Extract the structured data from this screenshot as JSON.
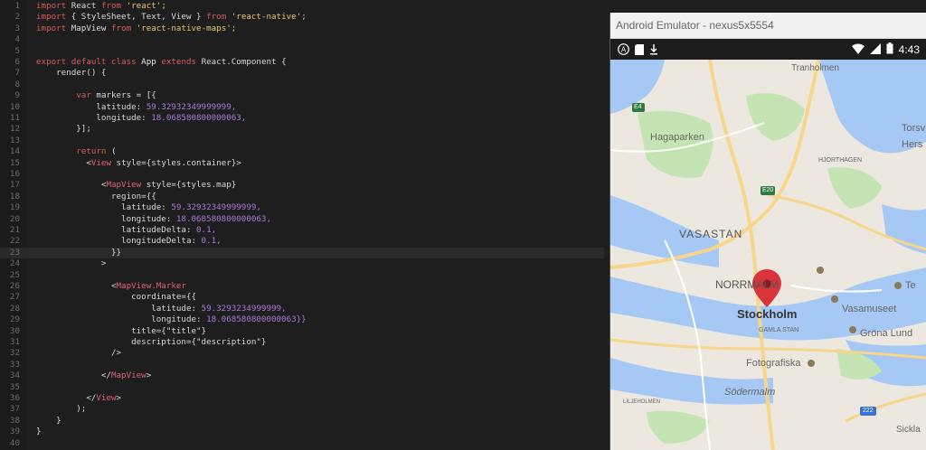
{
  "editor": {
    "lines": [
      {
        "n": "1",
        "seg": [
          {
            "t": "import ",
            "c": "kw"
          },
          {
            "t": "React ",
            "c": ""
          },
          {
            "t": "from ",
            "c": "kw"
          },
          {
            "t": "'react';",
            "c": "st"
          }
        ]
      },
      {
        "n": "2",
        "seg": [
          {
            "t": "import ",
            "c": "kw"
          },
          {
            "t": "{ StyleSheet, Text, View } ",
            "c": ""
          },
          {
            "t": "from ",
            "c": "kw"
          },
          {
            "t": "'react-native';",
            "c": "st"
          }
        ]
      },
      {
        "n": "3",
        "seg": [
          {
            "t": "import ",
            "c": "kw"
          },
          {
            "t": "MapView ",
            "c": ""
          },
          {
            "t": "from ",
            "c": "kw"
          },
          {
            "t": "'react-native-maps';",
            "c": "st"
          }
        ]
      },
      {
        "n": "4",
        "seg": []
      },
      {
        "n": "5",
        "seg": []
      },
      {
        "n": "6",
        "seg": [
          {
            "t": "export default class ",
            "c": "kw"
          },
          {
            "t": "App ",
            "c": "cl"
          },
          {
            "t": "extends ",
            "c": "kw"
          },
          {
            "t": "React.Component {",
            "c": ""
          }
        ]
      },
      {
        "n": "7",
        "seg": [
          {
            "t": "    render() {",
            "c": ""
          }
        ]
      },
      {
        "n": "8",
        "seg": []
      },
      {
        "n": "9",
        "seg": [
          {
            "t": "        ",
            "c": ""
          },
          {
            "t": "var ",
            "c": "kw"
          },
          {
            "t": "markers = [{",
            "c": ""
          }
        ]
      },
      {
        "n": "10",
        "seg": [
          {
            "t": "            latitude: ",
            "c": ""
          },
          {
            "t": "59.32932349999999,",
            "c": "nm"
          }
        ]
      },
      {
        "n": "11",
        "seg": [
          {
            "t": "            longitude: ",
            "c": ""
          },
          {
            "t": "18.068580800000063,",
            "c": "nm"
          }
        ]
      },
      {
        "n": "12",
        "seg": [
          {
            "t": "        }];",
            "c": ""
          }
        ]
      },
      {
        "n": "13",
        "seg": []
      },
      {
        "n": "14",
        "seg": [
          {
            "t": "        ",
            "c": ""
          },
          {
            "t": "return ",
            "c": "kw"
          },
          {
            "t": "(",
            "c": ""
          }
        ]
      },
      {
        "n": "15",
        "seg": [
          {
            "t": "          <",
            "c": ""
          },
          {
            "t": "View ",
            "c": "tg"
          },
          {
            "t": "style={styles.container}>",
            "c": ""
          }
        ]
      },
      {
        "n": "16",
        "seg": []
      },
      {
        "n": "17",
        "seg": [
          {
            "t": "             <",
            "c": ""
          },
          {
            "t": "MapView ",
            "c": "tg"
          },
          {
            "t": "style={styles.map}",
            "c": ""
          }
        ]
      },
      {
        "n": "18",
        "seg": [
          {
            "t": "               region={{",
            "c": ""
          }
        ]
      },
      {
        "n": "19",
        "seg": [
          {
            "t": "                 latitude: ",
            "c": ""
          },
          {
            "t": "59.32932349999999,",
            "c": "nm"
          }
        ]
      },
      {
        "n": "20",
        "seg": [
          {
            "t": "                 longitude: ",
            "c": ""
          },
          {
            "t": "18.068580800000063,",
            "c": "nm"
          }
        ]
      },
      {
        "n": "21",
        "seg": [
          {
            "t": "                 latitudeDelta: ",
            "c": ""
          },
          {
            "t": "0.1,",
            "c": "nm"
          }
        ]
      },
      {
        "n": "22",
        "seg": [
          {
            "t": "                 longitudeDelta: ",
            "c": ""
          },
          {
            "t": "0.1,",
            "c": "nm"
          }
        ]
      },
      {
        "n": "23",
        "seg": [
          {
            "t": "               }}",
            "c": ""
          }
        ]
      },
      {
        "n": "24",
        "seg": [
          {
            "t": "             >",
            "c": ""
          }
        ]
      },
      {
        "n": "25",
        "seg": []
      },
      {
        "n": "26",
        "seg": [
          {
            "t": "               <",
            "c": ""
          },
          {
            "t": "MapView.Marker",
            "c": "tg"
          }
        ]
      },
      {
        "n": "27",
        "seg": [
          {
            "t": "                   coordinate={{",
            "c": ""
          }
        ]
      },
      {
        "n": "28",
        "seg": [
          {
            "t": "                       latitude: ",
            "c": ""
          },
          {
            "t": "59.3293234999999,",
            "c": "nm"
          }
        ]
      },
      {
        "n": "29",
        "seg": [
          {
            "t": "                       longitude: ",
            "c": ""
          },
          {
            "t": "18.068580800000063}}",
            "c": "nm"
          }
        ]
      },
      {
        "n": "30",
        "seg": [
          {
            "t": "                   title={\"title\"}",
            "c": ""
          }
        ]
      },
      {
        "n": "31",
        "seg": [
          {
            "t": "                   description={\"description\"}",
            "c": ""
          }
        ]
      },
      {
        "n": "32",
        "seg": [
          {
            "t": "               />",
            "c": ""
          }
        ]
      },
      {
        "n": "33",
        "seg": []
      },
      {
        "n": "34",
        "seg": [
          {
            "t": "             </",
            "c": ""
          },
          {
            "t": "MapView",
            "c": "tg"
          },
          {
            "t": ">",
            "c": ""
          }
        ]
      },
      {
        "n": "35",
        "seg": []
      },
      {
        "n": "36",
        "seg": [
          {
            "t": "          </",
            "c": ""
          },
          {
            "t": "View",
            "c": "tg"
          },
          {
            "t": ">",
            "c": ""
          }
        ]
      },
      {
        "n": "37",
        "seg": [
          {
            "t": "        );",
            "c": ""
          }
        ]
      },
      {
        "n": "38",
        "seg": [
          {
            "t": "    }",
            "c": ""
          }
        ]
      },
      {
        "n": "39",
        "seg": [
          {
            "t": "}",
            "c": ""
          }
        ]
      },
      {
        "n": "40",
        "seg": []
      }
    ],
    "active_line": "23"
  },
  "emulator": {
    "title": "Android Emulator - nexus5x5554",
    "status_time": "4:43",
    "status_icons": [
      "app-a-icon",
      "sd-card-icon",
      "download-icon",
      "wifi-icon",
      "signal-icon",
      "battery-icon"
    ]
  },
  "map": {
    "labels": {
      "tranholmen": "Tranholmen",
      "torsvik": "Torsv",
      "hersby": "Hers",
      "hagaparken": "Hagaparken",
      "vasastan": "VASASTAN",
      "norrmalm": "NORRMALM",
      "stockholm": "Stockholm",
      "gamla_stan": "GAMLA STAN",
      "vasamuseet": "Vasamuseet",
      "tekniska": "Te",
      "grona_lund": "Gröna Lund",
      "fotografiska": "Fotografiska",
      "sodermalm": "Södermalm",
      "sickla": "Sickla",
      "hjorthagen": "HJORTHAGEN",
      "liljeholmen": "LILJEHOLMEN",
      "e4": "E4",
      "e20": "E20",
      "r222": "222"
    },
    "colors": {
      "water": "#a6c8f4",
      "land": "#ece8e0",
      "park": "#c4e5b3",
      "road": "#f7d58a",
      "pin": "#d9343a"
    }
  }
}
